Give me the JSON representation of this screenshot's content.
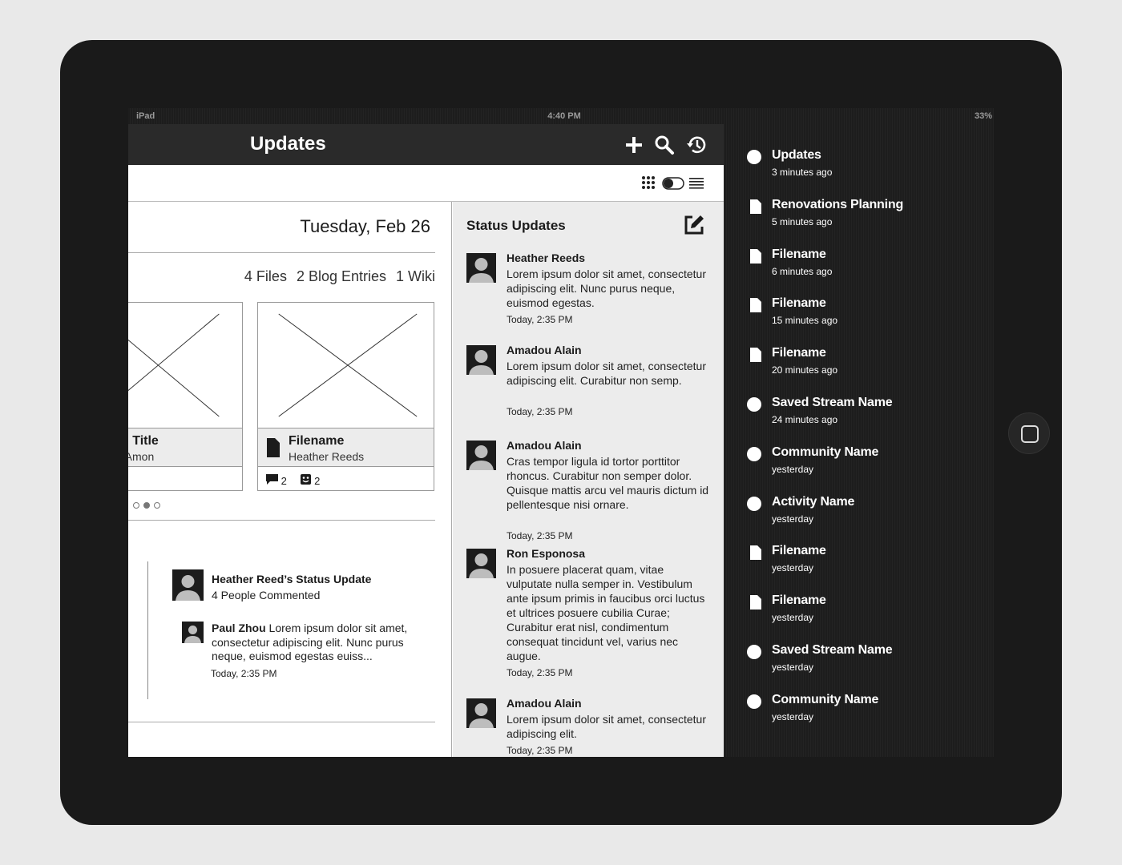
{
  "statusbar": {
    "carrier": "iPad",
    "time": "4:40 PM",
    "battery": "33%"
  },
  "navbar": {
    "title": "Updates",
    "icons": [
      "plus-icon",
      "search-icon",
      "history-icon"
    ]
  },
  "toolbar": {
    "icons": [
      "grid-view-icon",
      "toggle-icon",
      "list-view-icon"
    ]
  },
  "main": {
    "date": "Tuesday, Feb 26",
    "counts": [
      "4 Files",
      "2 Blog Entries",
      "1 Wiki"
    ],
    "cards": [
      {
        "name": "g Title",
        "sub": "-Amon"
      },
      {
        "name": "Filename",
        "sub": "Heather Reeds",
        "comments": "2",
        "likes": "2"
      }
    ],
    "activity": {
      "title": "Heather Reed’s Status Update",
      "subtitle": "4 People Commented",
      "comment_author": "Paul Zhou",
      "comment_text": " Lorem ipsum dolor sit amet, consectetur adipiscing elit. Nunc purus neque, euismod egestas euiss...",
      "comment_time": "Today, 2:35 PM"
    }
  },
  "status_updates": {
    "title": "Status Updates",
    "posts": [
      {
        "name": "Heather Reeds",
        "text": "Lorem ipsum dolor sit amet, consectetur adipiscing elit. Nunc purus neque, euismod egestas.",
        "time": "Today, 2:35 PM"
      },
      {
        "name": "Amadou Alain",
        "text": "Lorem ipsum dolor sit amet, consectetur adipiscing elit. Curabitur non semp.",
        "time": "Today, 2:35 PM"
      },
      {
        "name": "Amadou Alain",
        "text": "Cras tempor ligula id tortor porttitor rhoncus. Curabitur non semper dolor. Quisque mattis arcu vel mauris dictum id pellentesque nisi ornare.",
        "time": "Today, 2:35 PM"
      },
      {
        "name": "Ron Esponosa",
        "text": "In posuere placerat quam, vitae vulputate nulla semper in. Vestibulum ante ipsum primis in faucibus orci luctus et ultrices posuere cubilia Curae; Curabitur erat nisl, condimentum consequat tincidunt vel, varius nec augue.",
        "time": "Today, 2:35 PM"
      },
      {
        "name": "Amadou Alain",
        "text": "Lorem ipsum dolor sit amet, consectetur adipiscing elit.",
        "time": "Today, 2:35 PM"
      }
    ]
  },
  "sidebar": {
    "items": [
      {
        "name": "Updates",
        "time": "3 minutes ago",
        "icon": "circle-icon"
      },
      {
        "name": "Renovations Planning",
        "time": "5 minutes ago",
        "icon": "document-icon"
      },
      {
        "name": "Filename",
        "time": "6 minutes ago",
        "icon": "document-icon"
      },
      {
        "name": "Filename",
        "time": "15 minutes ago",
        "icon": "document-icon"
      },
      {
        "name": "Filename",
        "time": "20 minutes ago",
        "icon": "document-icon"
      },
      {
        "name": "Saved Stream Name",
        "time": "24 minutes ago",
        "icon": "circle-icon"
      },
      {
        "name": "Community Name",
        "time": "yesterday",
        "icon": "circle-icon"
      },
      {
        "name": "Activity Name",
        "time": "yesterday",
        "icon": "circle-icon"
      },
      {
        "name": "Filename",
        "time": "yesterday",
        "icon": "document-icon"
      },
      {
        "name": "Filename",
        "time": "yesterday",
        "icon": "document-icon"
      },
      {
        "name": "Saved Stream Name",
        "time": "yesterday",
        "icon": "circle-icon"
      },
      {
        "name": "Community Name",
        "time": "yesterday",
        "icon": "circle-icon"
      }
    ]
  }
}
